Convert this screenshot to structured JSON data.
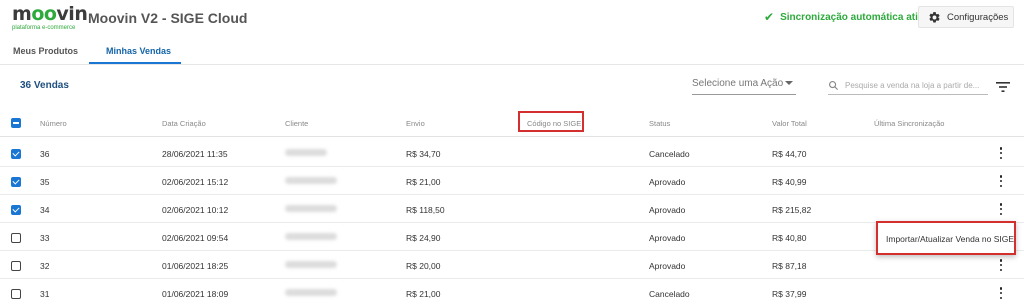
{
  "header": {
    "logo_word": "moovin",
    "logo_subtitle": "plataforma e-commerce",
    "app_title": "Moovin V2 - SIGE Cloud",
    "sync_status": "Sincronização automática ativa",
    "config_label": "Configurações"
  },
  "tabs": [
    {
      "label": "Meus Produtos",
      "active": false
    },
    {
      "label": "Minhas Vendas",
      "active": true
    }
  ],
  "toolbar": {
    "count_label": "36 Vendas",
    "action_placeholder": "Selecione uma Ação",
    "search_placeholder": "Pesquise a venda na loja a partir de..."
  },
  "table": {
    "headers": {
      "numero": "Número",
      "data": "Data Criação",
      "cliente": "Cliente",
      "envio": "Envio",
      "codigo": "Código no SIGE",
      "status": "Status",
      "valor": "Valor Total",
      "sync": "Última Sincronização"
    },
    "rows": [
      {
        "checked": true,
        "numero": "36",
        "data": "28/06/2021 11:35",
        "envio": "R$ 34,70",
        "status": "Cancelado",
        "valor": "R$ 44,70"
      },
      {
        "checked": true,
        "numero": "35",
        "data": "02/06/2021 15:12",
        "envio": "R$ 21,00",
        "status": "Aprovado",
        "valor": "R$ 40,99"
      },
      {
        "checked": true,
        "numero": "34",
        "data": "02/06/2021 10:12",
        "envio": "R$ 118,50",
        "status": "Aprovado",
        "valor": "R$ 215,82"
      },
      {
        "checked": false,
        "numero": "33",
        "data": "02/06/2021 09:54",
        "envio": "R$ 24,90",
        "status": "Aprovado",
        "valor": "R$ 40,80"
      },
      {
        "checked": false,
        "numero": "32",
        "data": "01/06/2021 18:25",
        "envio": "R$ 20,00",
        "status": "Aprovado",
        "valor": "R$ 87,18"
      },
      {
        "checked": false,
        "numero": "31",
        "data": "01/06/2021 18:09",
        "envio": "R$ 21,00",
        "status": "Cancelado",
        "valor": "R$ 37,99"
      }
    ]
  },
  "row_menu": {
    "item_label": "Importar/Atualizar Venda no SIGE"
  },
  "colors": {
    "brand_green": "#2eaa3c",
    "accent_blue": "#1976d2",
    "highlight_red": "#d32f2f"
  }
}
